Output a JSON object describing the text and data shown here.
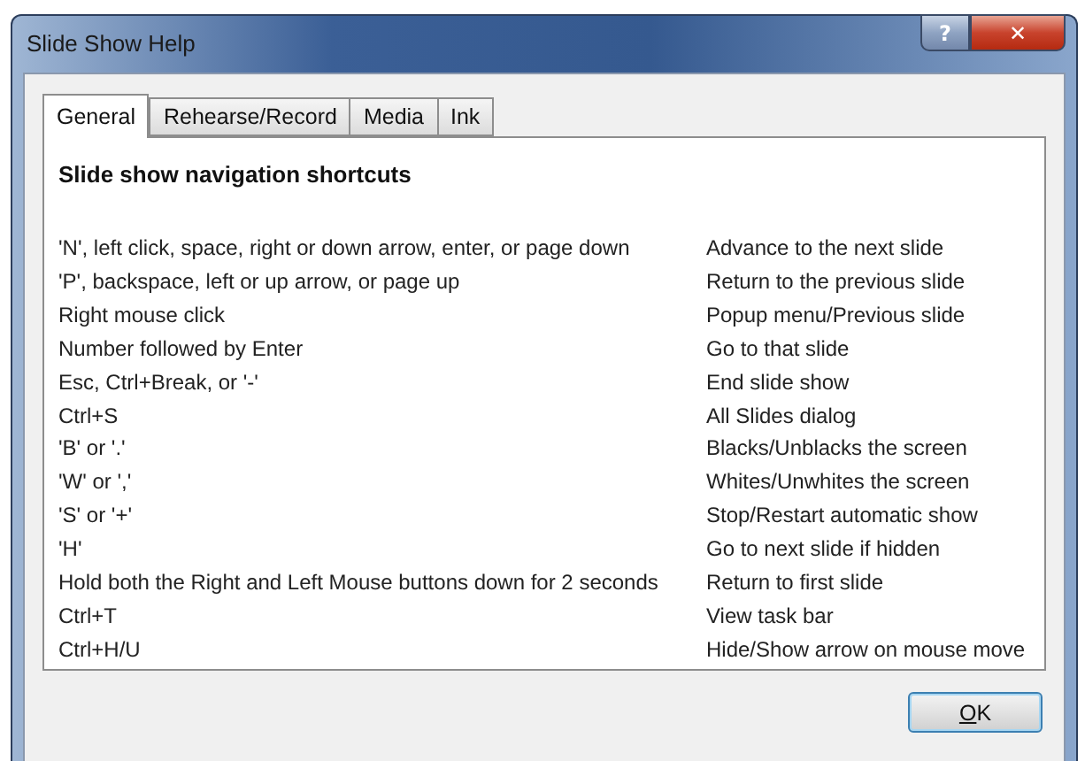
{
  "window": {
    "title": "Slide Show Help",
    "help_button": "?",
    "close_button": "✕"
  },
  "tabs": [
    {
      "label": "General",
      "selected": true
    },
    {
      "label": "Rehearse/Record",
      "selected": false
    },
    {
      "label": "Media",
      "selected": false
    },
    {
      "label": "Ink",
      "selected": false
    }
  ],
  "heading": "Slide show navigation shortcuts",
  "shortcuts": [
    {
      "keys": "'N', left click, space, right or down arrow, enter, or page down",
      "action": "Advance to the next slide"
    },
    {
      "keys": "'P', backspace, left or up arrow, or page up",
      "action": "Return to the previous slide"
    },
    {
      "keys": "Right mouse click",
      "action": "Popup menu/Previous slide"
    },
    {
      "keys": "Number followed by Enter",
      "action": "Go to that slide"
    },
    {
      "keys": "Esc, Ctrl+Break, or '-'",
      "action": "End slide show"
    },
    {
      "keys": "Ctrl+S",
      "action": "All Slides dialog"
    },
    {
      "keys": "'B' or '.'",
      "action": "Blacks/Unblacks the screen"
    },
    {
      "keys": "'W' or ','",
      "action": "Whites/Unwhites the screen"
    },
    {
      "keys": "'S' or '+'",
      "action": "Stop/Restart automatic show"
    },
    {
      "keys": "'H'",
      "action": "Go to next slide if hidden"
    },
    {
      "keys": "Hold both the Right and Left Mouse buttons down for 2 seconds",
      "action": "Return to first slide"
    },
    {
      "keys": "Ctrl+T",
      "action": "View task bar"
    },
    {
      "keys": "Ctrl+H/U",
      "action": "Hide/Show arrow on mouse move"
    }
  ],
  "ok_button": {
    "label_parts": [
      {
        "text": "O",
        "underlined": true
      },
      {
        "text": "K",
        "underlined": false
      }
    ]
  }
}
